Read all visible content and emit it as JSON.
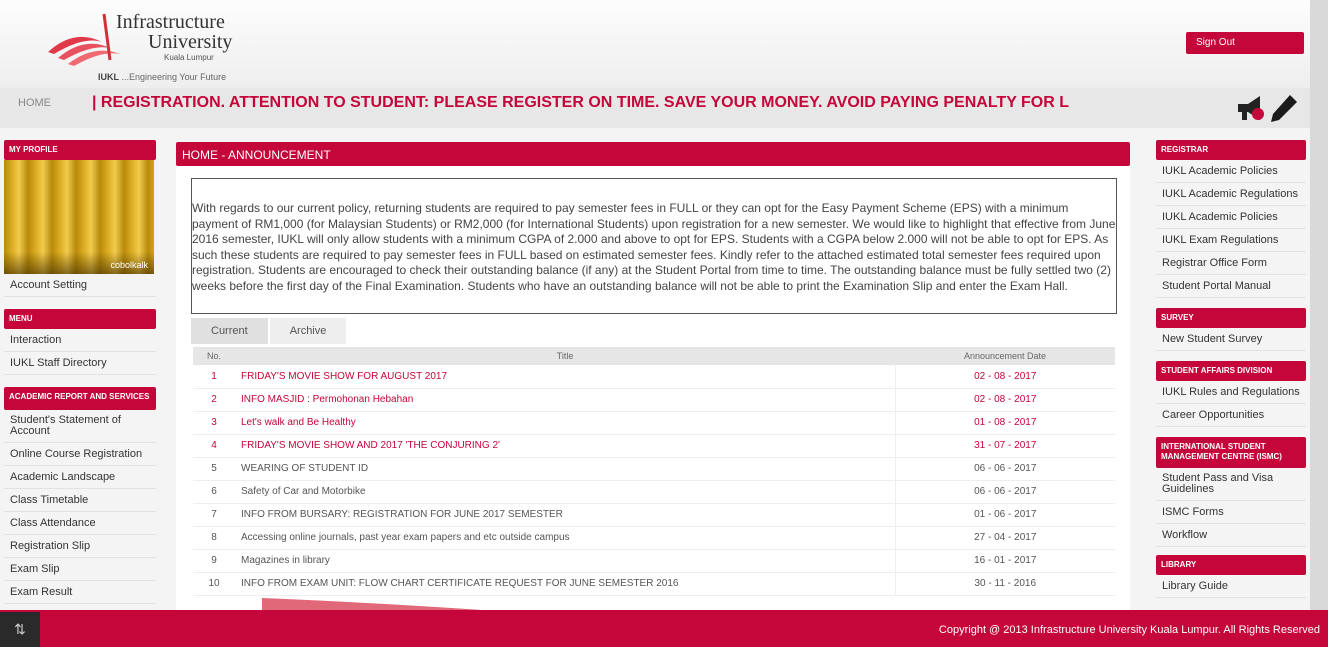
{
  "header": {
    "logo_line1": "Infrastructure",
    "logo_line2": "University",
    "logo_sub": "Kuala Lumpur",
    "tag_brand": "IUKL",
    "tag_text": "...Engineering Your Future",
    "signout_label": "Sign Out"
  },
  "nav": {
    "home": "HOME",
    "marquee": "| REGISTRATION.          ATTENTION TO STUDENT:  PLEASE REGISTER ON TIME.   SAVE YOUR MONEY.   AVOID PAYING PENALTY FOR L"
  },
  "left": {
    "profile_head": "MY PROFILE",
    "profile_caption": "cobolkalk",
    "account_setting": "Account Setting",
    "menu_head": "MENU",
    "menu_items": [
      "Interaction",
      "IUKL Staff Directory"
    ],
    "academic_head": "ACADEMIC REPORT AND SERVICES",
    "academic_items": [
      "Student's Statement of Account",
      "Online Course Registration",
      "Academic Landscape",
      "Class Timetable",
      "Class Attendance",
      "Registration Slip",
      "Exam Slip",
      "Exam Result"
    ]
  },
  "main": {
    "title": "HOME - ANNOUNCEMENT",
    "notice": "With regards to our current policy, returning students are required to pay semester fees in FULL or they can opt for the Easy Payment Scheme (EPS) with a minimum payment of RM1,000 (for Malaysian Students) or RM2,000 (for International Students) upon registration for a new semester. We would like to highlight that effective from June 2016 semester, IUKL will only allow students with a minimum CGPA of 2.000 and above to opt for EPS. Students with a CGPA below 2.000 will not be able to opt for EPS. As such these students are required to pay semester fees in FULL based on estimated semester fees. Kindly refer to the attached estimated total semester fees required upon registration. Students are encouraged to check their outstanding balance (if any) at the Student Portal from time to time. The outstanding balance must be fully settled two (2) weeks before the first day of the Final Examination. Students who have an outstanding balance will not be able to print the Examination Slip and enter the Exam Hall.",
    "tabs": [
      "Current",
      "Archive"
    ],
    "columns": [
      "No.",
      "Title",
      "Announcement Date"
    ],
    "rows": [
      {
        "no": "1",
        "title": "FRIDAY'S MOVIE SHOW FOR AUGUST 2017",
        "date": "02 - 08 - 2017"
      },
      {
        "no": "2",
        "title": "INFO MASJID : Permohonan Hebahan",
        "date": "02 - 08 - 2017"
      },
      {
        "no": "3",
        "title": "Let's walk and Be Healthy",
        "date": "01 - 08 - 2017"
      },
      {
        "no": "4",
        "title": "FRIDAY'S MOVIE SHOW AND 2017 'THE CONJURING 2'",
        "date": "31 - 07 - 2017"
      },
      {
        "no": "5",
        "title": "WEARING OF STUDENT ID",
        "date": "06 - 06 - 2017"
      },
      {
        "no": "6",
        "title": "Safety of Car and Motorbike",
        "date": "06 - 06 - 2017"
      },
      {
        "no": "7",
        "title": "INFO FROM BURSARY: REGISTRATION FOR JUNE 2017 SEMESTER",
        "date": "01 - 06 - 2017"
      },
      {
        "no": "8",
        "title": "Accessing online journals, past year exam papers and etc outside campus",
        "date": "27 - 04 - 2017"
      },
      {
        "no": "9",
        "title": "Magazines in library",
        "date": "16 - 01 - 2017"
      },
      {
        "no": "10",
        "title": "INFO FROM EXAM UNIT: FLOW CHART CERTIFICATE REQUEST FOR JUNE SEMESTER 2016",
        "date": "30 - 11 - 2016"
      }
    ]
  },
  "right": {
    "registrar_head": "REGISTRAR",
    "registrar_items": [
      "IUKL Academic Policies",
      "IUKL Academic Regulations",
      "IUKL Academic Policies",
      "IUKL Exam Regulations",
      "Registrar Office Form",
      "Student Portal Manual"
    ],
    "survey_head": "SURVEY",
    "survey_items": [
      "New Student Survey"
    ],
    "sad_head": "STUDENT AFFAIRS DIVISION",
    "sad_items": [
      "IUKL Rules and Regulations",
      "Career Opportunities"
    ],
    "ismc_head": "INTERNATIONAL STUDENT MANAGEMENT CENTRE (ISMC)",
    "ismc_items": [
      "Student Pass and Visa Guidelines",
      "ISMC Forms",
      "Workflow"
    ],
    "library_head": "LIBRARY",
    "library_items": [
      "Library Guide"
    ]
  },
  "footer": {
    "copyright": "Copyright @ 2013 Infrastructure University Kuala Lumpur. All Rights Reserved"
  },
  "colors": {
    "brand": "#c4063a",
    "background": "#f4f4f4"
  }
}
